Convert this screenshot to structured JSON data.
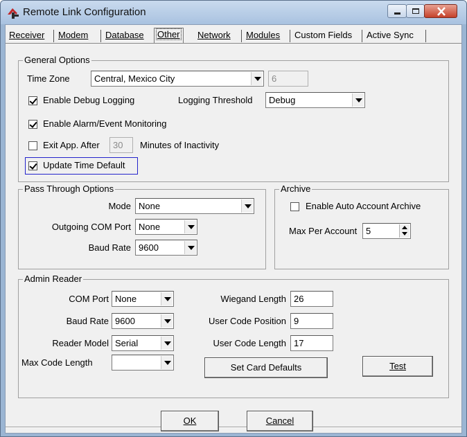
{
  "window": {
    "title": "Remote Link Configuration"
  },
  "tabs": [
    {
      "label": "Receiver"
    },
    {
      "label": "Modem"
    },
    {
      "label": "Database"
    },
    {
      "label": "Other"
    },
    {
      "label": "Network"
    },
    {
      "label": "Modules"
    },
    {
      "label": "Custom Fields"
    },
    {
      "label": "Active Sync"
    }
  ],
  "active_tab": "Other",
  "general": {
    "title": "General Options",
    "time_zone_label": "Time Zone",
    "time_zone_value": "Central, Mexico City",
    "time_zone_offset": "6",
    "debug_logging_label": "Enable Debug Logging",
    "debug_logging_checked": true,
    "logging_threshold_label": "Logging Threshold",
    "logging_threshold_value": "Debug",
    "alarm_monitoring_label": "Enable Alarm/Event Monitoring",
    "alarm_monitoring_checked": true,
    "exit_app_label": "Exit App. After",
    "exit_app_checked": false,
    "exit_minutes_value": "30",
    "exit_minutes_suffix": "Minutes of Inactivity",
    "update_time_label": "Update Time Default",
    "update_time_checked": true
  },
  "pass_through": {
    "title": "Pass Through Options",
    "mode_label": "Mode",
    "mode_value": "None",
    "com_port_label": "Outgoing COM Port",
    "com_port_value": "None",
    "baud_label": "Baud Rate",
    "baud_value": "9600"
  },
  "archive": {
    "title": "Archive",
    "auto_archive_label": "Enable Auto Account Archive",
    "auto_archive_checked": false,
    "max_per_account_label": "Max Per Account",
    "max_per_account_value": "5"
  },
  "admin_reader": {
    "title": "Admin Reader",
    "com_port_label": "COM Port",
    "com_port_value": "None",
    "baud_label": "Baud Rate",
    "baud_value": "9600",
    "reader_model_label": "Reader Model",
    "reader_model_value": "Serial",
    "max_code_label": "Max Code Length",
    "max_code_value": "",
    "wiegand_label": "Wiegand Length",
    "wiegand_value": "26",
    "user_code_pos_label": "User Code Position",
    "user_code_pos_value": "9",
    "user_code_len_label": "User Code Length",
    "user_code_len_value": "17",
    "set_defaults_label": "Set Card Defaults",
    "test_label": "Test"
  },
  "footer": {
    "ok_label": "OK",
    "cancel_label": "Cancel"
  },
  "colors": {
    "highlight_border": "#2222cc",
    "titlebar": "#b9cde6"
  }
}
